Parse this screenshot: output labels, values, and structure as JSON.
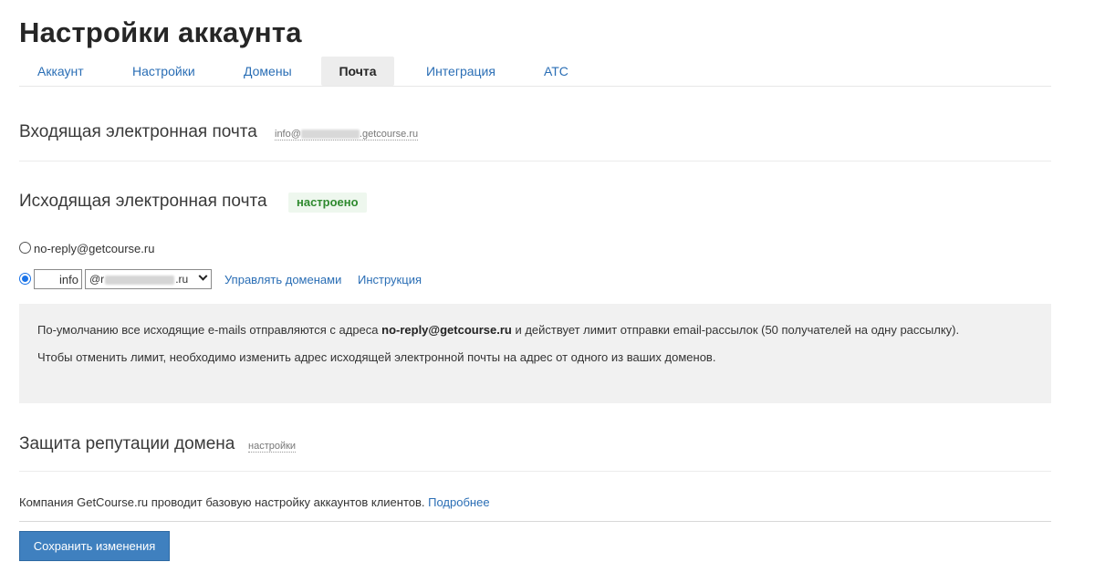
{
  "page": {
    "title": "Настройки аккаунта"
  },
  "tabs": [
    {
      "label": "Аккаунт"
    },
    {
      "label": "Настройки"
    },
    {
      "label": "Домены"
    },
    {
      "label": "Почта",
      "active": true
    },
    {
      "label": "Интеграция"
    },
    {
      "label": "АТС"
    }
  ],
  "incoming": {
    "heading": "Входящая электронная почта",
    "address_prefix": "info@",
    "address_suffix": ".getcourse.ru"
  },
  "outgoing": {
    "heading": "Исходящая электронная почта",
    "status_badge": "настроено",
    "option_default_label": "no-reply@getcourse.ru",
    "option_custom_mailbox_value": "info",
    "option_custom_domain_prefix": "@r",
    "option_custom_domain_suffix": ".ru",
    "manage_domains_link": "Управлять доменами",
    "instruction_link": "Инструкция",
    "selected_option": "custom"
  },
  "info": {
    "line1_before": "По-умолчанию все исходящие e-mails отправляются с адреса ",
    "line1_bold": "no-reply@getcourse.ru",
    "line1_after": " и действует лимит отправки email-рассылок (50 получателей на одну рассылку).",
    "line2": "Чтобы отменить лимит, необходимо изменить адрес исходящей электронной почты на адрес от одного из ваших доменов."
  },
  "reputation": {
    "heading": "Защита репутации домена",
    "settings_link": "настройки"
  },
  "footer": {
    "note": "Компания GetCourse.ru проводит базовую настройку аккаунтов клиентов.",
    "more_link": "Подробнее"
  },
  "actions": {
    "save_label": "Сохранить изменения"
  },
  "colors": {
    "accent": "#2a6eb5",
    "button": "#3f80bf",
    "badge_text": "#2f8a2f",
    "info_bg": "#f1f1f1"
  }
}
